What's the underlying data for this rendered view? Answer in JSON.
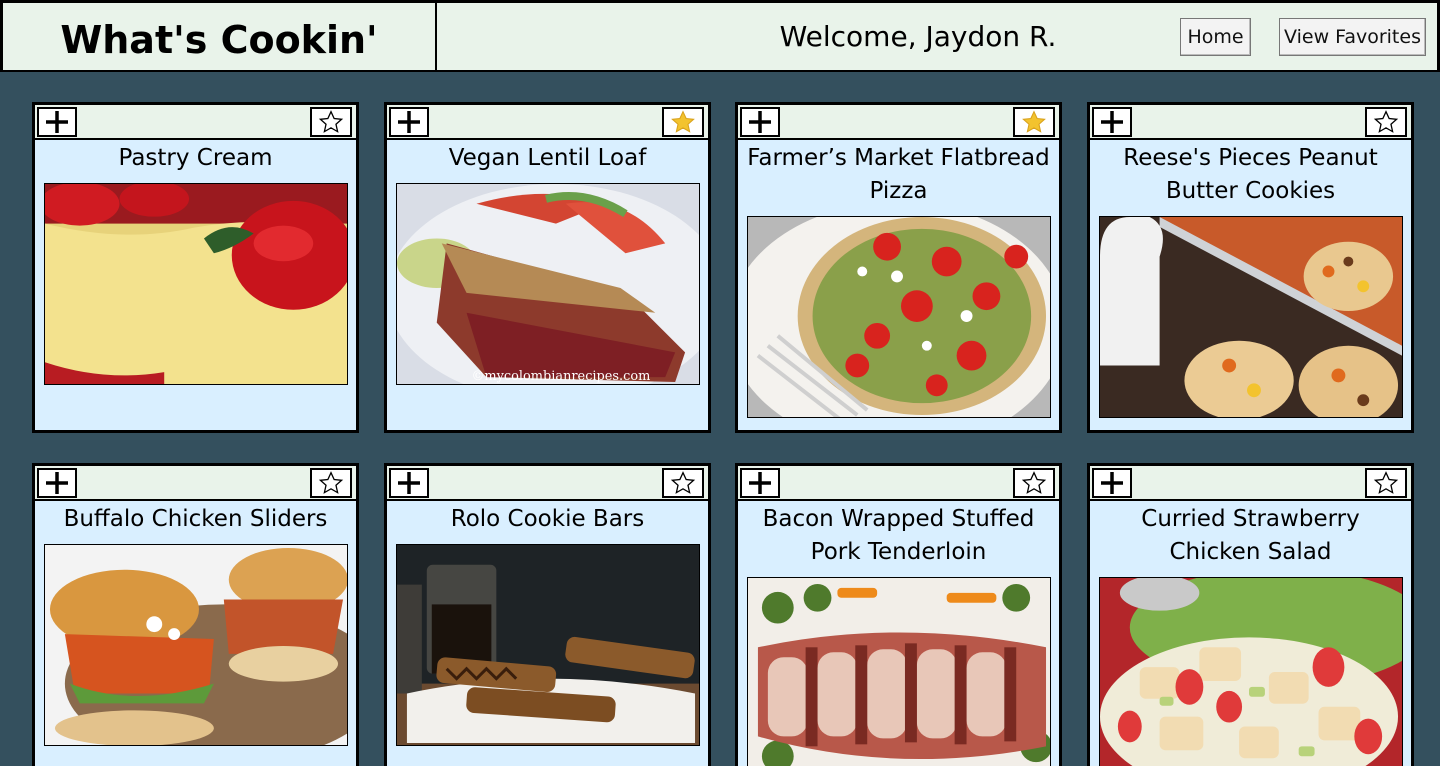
{
  "header": {
    "brand": "What's Cookin'",
    "welcome": "Welcome, Jaydon R.",
    "home_label": "Home",
    "favorites_label": "View Favorites"
  },
  "colors": {
    "page_bg": "#34505e",
    "header_bg": "#e9f3ea",
    "card_bg": "#d9efff",
    "star_on": "#f3c32e"
  },
  "recipes": [
    {
      "title": "Pastry Cream",
      "favorited": false,
      "image": "strawberry-cream-tart"
    },
    {
      "title": "Vegan Lentil Loaf",
      "favorited": true,
      "image": "lentil-loaf-slice",
      "watermark": "©mycolombianrecipes.com"
    },
    {
      "title": "Farmer’s Market Flatbread Pizza",
      "favorited": true,
      "image": "flatbread-pizza"
    },
    {
      "title": "Reese's Pieces Peanut Butter Cookies",
      "favorited": false,
      "image": "peanut-butter-cookies"
    },
    {
      "title": "Buffalo Chicken Sliders",
      "favorited": false,
      "image": "chicken-sliders"
    },
    {
      "title": "Rolo Cookie Bars",
      "favorited": false,
      "image": "cookie-bars"
    },
    {
      "title": "Bacon Wrapped Stuffed Pork Tenderloin",
      "favorited": false,
      "image": "pork-tenderloin"
    },
    {
      "title": "Curried Strawberry Chicken Salad",
      "favorited": false,
      "image": "chicken-salad"
    }
  ]
}
